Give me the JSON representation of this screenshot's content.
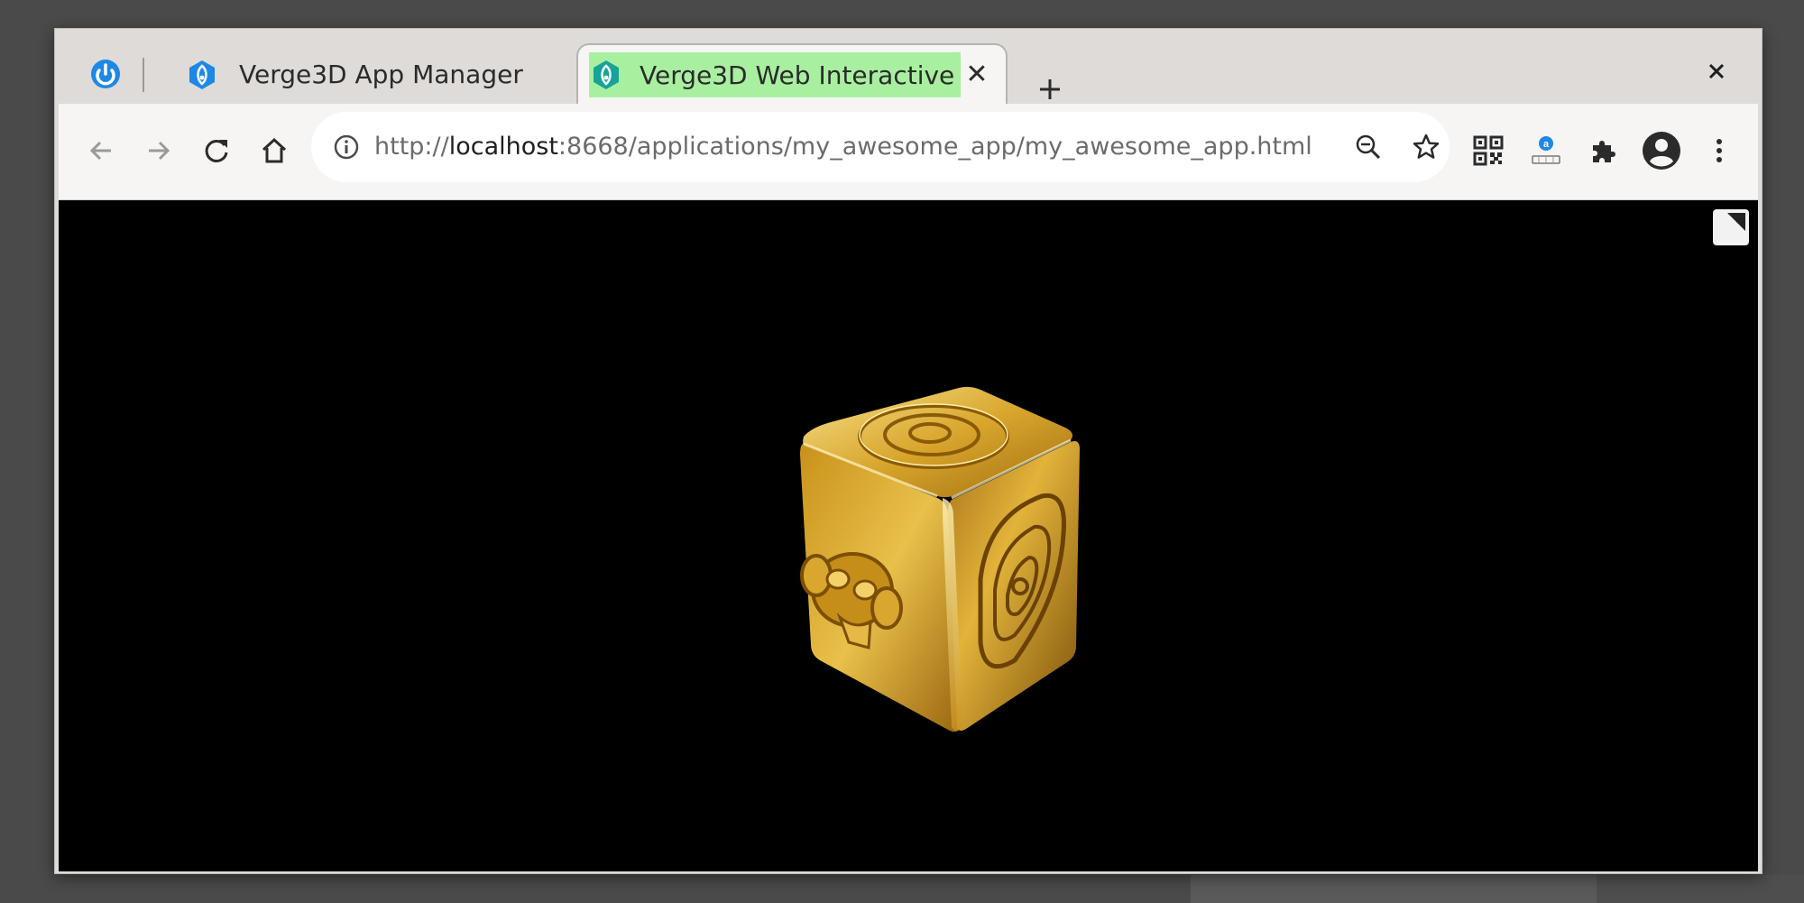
{
  "tabs": [
    {
      "title": "Verge3D App Manager",
      "icon": "verge3d-icon",
      "active": false
    },
    {
      "title": "Verge3D Web Interactive",
      "icon": "verge3d-icon",
      "active": true
    }
  ],
  "pinned_tab": {
    "icon": "power-icon"
  },
  "address": {
    "scheme": "http://",
    "host": "localhost",
    "rest": ":8668/applications/my_awesome_app/my_awesome_app.html"
  },
  "toolbar_icons": [
    "back-arrow-icon",
    "forward-arrow-icon",
    "reload-icon",
    "home-icon",
    "info-icon",
    "zoom-out-icon",
    "star-icon",
    "qr-code-icon",
    "amazon-assistant-icon",
    "extensions-icon",
    "account-icon",
    "menu-icon"
  ],
  "colors": {
    "active_tab_highlight": "#a8f0a0",
    "verge3d_blue": "#1e88e5",
    "gold": "#d4a017"
  }
}
